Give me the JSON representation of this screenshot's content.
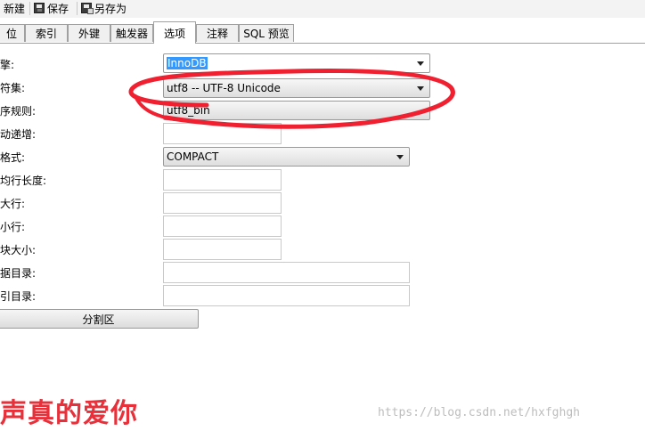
{
  "toolbar": {
    "new_label": "新建",
    "save_label": "保存",
    "save_as_label": "另存为"
  },
  "tabs": [
    {
      "label": "位"
    },
    {
      "label": "索引"
    },
    {
      "label": "外键"
    },
    {
      "label": "触发器"
    },
    {
      "label": "选项",
      "active": true
    },
    {
      "label": "注释"
    },
    {
      "label": "SQL 预览"
    }
  ],
  "form": {
    "engine": {
      "label": "擎:",
      "value": "InnoDB"
    },
    "charset": {
      "label": "符集:",
      "value": "utf8 -- UTF-8 Unicode"
    },
    "collation": {
      "label": "序规则:",
      "value": "utf8_bin"
    },
    "auto_increment": {
      "label": "动递增:",
      "value": ""
    },
    "row_format": {
      "label": "格式:",
      "value": "COMPACT"
    },
    "avg_row_length": {
      "label": "均行长度:",
      "value": ""
    },
    "max_rows": {
      "label": "大行:",
      "value": ""
    },
    "min_rows": {
      "label": "小行:",
      "value": ""
    },
    "key_block_size": {
      "label": "块大小:",
      "value": ""
    },
    "data_directory": {
      "label": "据目录:",
      "value": ""
    },
    "index_directory": {
      "label": "引目录:",
      "value": ""
    },
    "partition_button": "分割区"
  },
  "annotation": {
    "handwritten_text": "声真的爱你",
    "color": "#e8303a"
  },
  "watermark": "https://blog.csdn.net/hxfghgh",
  "colors": {
    "selection": "#3399ff",
    "annotation_red": "#f02030"
  }
}
